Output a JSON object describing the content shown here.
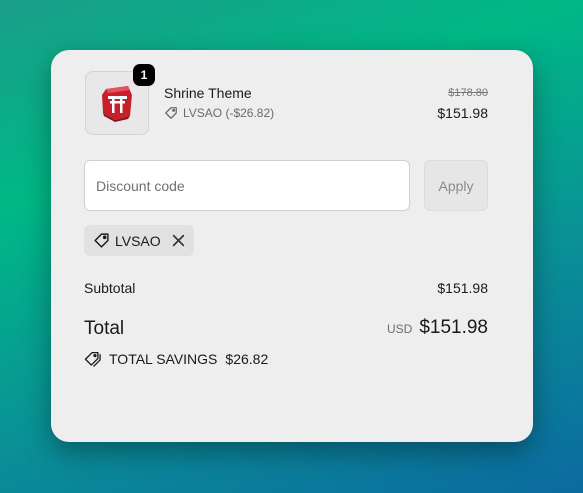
{
  "line_item": {
    "name": "Shrine Theme",
    "quantity": "1",
    "discount_label": "LVSAO (-$26.82)",
    "original_price": "$178.80",
    "price": "$151.98"
  },
  "discount": {
    "placeholder": "Discount code",
    "apply_label": "Apply",
    "applied_code": "LVSAO"
  },
  "summary": {
    "subtotal_label": "Subtotal",
    "subtotal_value": "$151.98",
    "total_label": "Total",
    "currency": "USD",
    "total_value": "$151.98",
    "savings_label": "TOTAL SAVINGS",
    "savings_value": "$26.82"
  },
  "colors": {
    "card_bg": "#eeeeee",
    "product_red": "#c8202a"
  }
}
